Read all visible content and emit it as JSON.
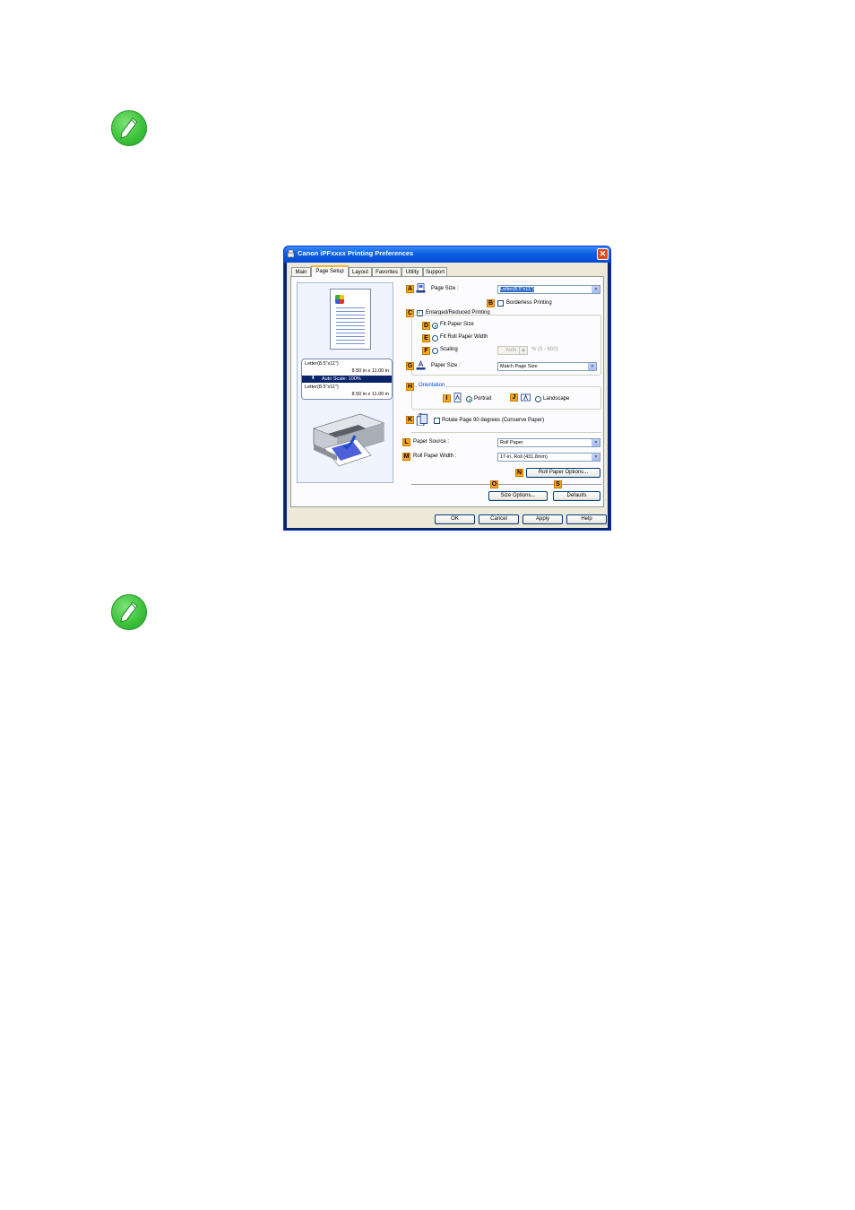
{
  "window": {
    "title": "Canon iPFxxxx Printing Preferences",
    "close_glyph": "✕"
  },
  "tabs": [
    "Main",
    "Page Setup",
    "Layout",
    "Favorites",
    "Utility",
    "Support"
  ],
  "active_tab": "Page Setup",
  "preview": {
    "paper_line1": "Letter(8.5\"x11\")",
    "paper_line2": "8.50 in x 11.00 in",
    "scale": "Auto Scale: 100%",
    "output_line1": "Letter(8.5\"x11\")",
    "output_line2": "8.50 in x 11.00 in",
    "arrow_glyph": "⬇"
  },
  "badges": {
    "A": "A",
    "B": "B",
    "C": "C",
    "D": "D",
    "E": "E",
    "F": "F",
    "G": "G",
    "H": "H",
    "I": "I",
    "J": "J",
    "K": "K",
    "L": "L",
    "M": "M",
    "N": "N",
    "O": "O",
    "S": "S"
  },
  "settings": {
    "page_size_label": "Page Size :",
    "page_size_value": "Letter(8.5\"x11\")",
    "borderless_label": "Borderless Printing",
    "enlarged_label": "Enlarged/Reduced Printing",
    "fit_paper_size": "Fit Paper Size",
    "fit_roll_width": "Fit Roll Paper Width",
    "scaling": "Scaling",
    "scaling_value": "Auto",
    "scaling_range": "% (5 - 600)",
    "paper_size_label": "Paper Size :",
    "paper_size_value": "Match Page Size",
    "orientation_label": "Orientation",
    "portrait": "Portrait",
    "landscape": "Landscape",
    "rotate_label": "Rotate Page 90 degrees (Conserve Paper)",
    "paper_source_label": "Paper Source :",
    "paper_source_value": "Roll Paper",
    "roll_width_label": "Roll Paper Width :",
    "roll_width_value": "17-in. Roll (431.8mm)",
    "roll_options_button": "Roll Paper Options...",
    "size_options_button": "Size Options...",
    "defaults_button": "Defaults"
  },
  "footer": {
    "ok": "OK",
    "cancel": "Cancel",
    "apply": "Apply",
    "help": "Help"
  },
  "icons": [
    "note-icon",
    "pencil-icon",
    "printer-icon",
    "page-size-icon",
    "paper-size-icon",
    "portrait-icon",
    "landscape-icon",
    "rotate-page-icon"
  ],
  "colors": {
    "badge": "#f5a623",
    "titlebar": "#0a5fe0",
    "note": "#3cc23a"
  }
}
